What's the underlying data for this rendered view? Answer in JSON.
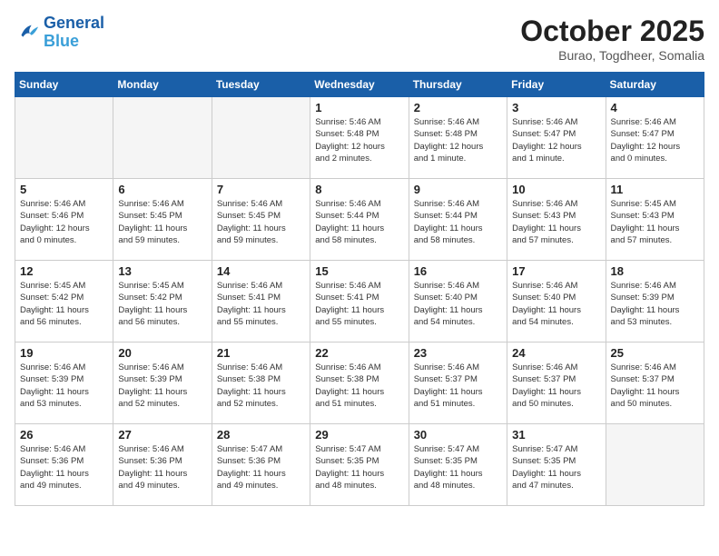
{
  "header": {
    "logo": {
      "line1": "General",
      "line2": "Blue"
    },
    "month": "October 2025",
    "location": "Burao, Togdheer, Somalia"
  },
  "weekdays": [
    "Sunday",
    "Monday",
    "Tuesday",
    "Wednesday",
    "Thursday",
    "Friday",
    "Saturday"
  ],
  "weeks": [
    [
      {
        "day": "",
        "info": ""
      },
      {
        "day": "",
        "info": ""
      },
      {
        "day": "",
        "info": ""
      },
      {
        "day": "1",
        "info": "Sunrise: 5:46 AM\nSunset: 5:48 PM\nDaylight: 12 hours\nand 2 minutes."
      },
      {
        "day": "2",
        "info": "Sunrise: 5:46 AM\nSunset: 5:48 PM\nDaylight: 12 hours\nand 1 minute."
      },
      {
        "day": "3",
        "info": "Sunrise: 5:46 AM\nSunset: 5:47 PM\nDaylight: 12 hours\nand 1 minute."
      },
      {
        "day": "4",
        "info": "Sunrise: 5:46 AM\nSunset: 5:47 PM\nDaylight: 12 hours\nand 0 minutes."
      }
    ],
    [
      {
        "day": "5",
        "info": "Sunrise: 5:46 AM\nSunset: 5:46 PM\nDaylight: 12 hours\nand 0 minutes."
      },
      {
        "day": "6",
        "info": "Sunrise: 5:46 AM\nSunset: 5:45 PM\nDaylight: 11 hours\nand 59 minutes."
      },
      {
        "day": "7",
        "info": "Sunrise: 5:46 AM\nSunset: 5:45 PM\nDaylight: 11 hours\nand 59 minutes."
      },
      {
        "day": "8",
        "info": "Sunrise: 5:46 AM\nSunset: 5:44 PM\nDaylight: 11 hours\nand 58 minutes."
      },
      {
        "day": "9",
        "info": "Sunrise: 5:46 AM\nSunset: 5:44 PM\nDaylight: 11 hours\nand 58 minutes."
      },
      {
        "day": "10",
        "info": "Sunrise: 5:46 AM\nSunset: 5:43 PM\nDaylight: 11 hours\nand 57 minutes."
      },
      {
        "day": "11",
        "info": "Sunrise: 5:45 AM\nSunset: 5:43 PM\nDaylight: 11 hours\nand 57 minutes."
      }
    ],
    [
      {
        "day": "12",
        "info": "Sunrise: 5:45 AM\nSunset: 5:42 PM\nDaylight: 11 hours\nand 56 minutes."
      },
      {
        "day": "13",
        "info": "Sunrise: 5:45 AM\nSunset: 5:42 PM\nDaylight: 11 hours\nand 56 minutes."
      },
      {
        "day": "14",
        "info": "Sunrise: 5:46 AM\nSunset: 5:41 PM\nDaylight: 11 hours\nand 55 minutes."
      },
      {
        "day": "15",
        "info": "Sunrise: 5:46 AM\nSunset: 5:41 PM\nDaylight: 11 hours\nand 55 minutes."
      },
      {
        "day": "16",
        "info": "Sunrise: 5:46 AM\nSunset: 5:40 PM\nDaylight: 11 hours\nand 54 minutes."
      },
      {
        "day": "17",
        "info": "Sunrise: 5:46 AM\nSunset: 5:40 PM\nDaylight: 11 hours\nand 54 minutes."
      },
      {
        "day": "18",
        "info": "Sunrise: 5:46 AM\nSunset: 5:39 PM\nDaylight: 11 hours\nand 53 minutes."
      }
    ],
    [
      {
        "day": "19",
        "info": "Sunrise: 5:46 AM\nSunset: 5:39 PM\nDaylight: 11 hours\nand 53 minutes."
      },
      {
        "day": "20",
        "info": "Sunrise: 5:46 AM\nSunset: 5:39 PM\nDaylight: 11 hours\nand 52 minutes."
      },
      {
        "day": "21",
        "info": "Sunrise: 5:46 AM\nSunset: 5:38 PM\nDaylight: 11 hours\nand 52 minutes."
      },
      {
        "day": "22",
        "info": "Sunrise: 5:46 AM\nSunset: 5:38 PM\nDaylight: 11 hours\nand 51 minutes."
      },
      {
        "day": "23",
        "info": "Sunrise: 5:46 AM\nSunset: 5:37 PM\nDaylight: 11 hours\nand 51 minutes."
      },
      {
        "day": "24",
        "info": "Sunrise: 5:46 AM\nSunset: 5:37 PM\nDaylight: 11 hours\nand 50 minutes."
      },
      {
        "day": "25",
        "info": "Sunrise: 5:46 AM\nSunset: 5:37 PM\nDaylight: 11 hours\nand 50 minutes."
      }
    ],
    [
      {
        "day": "26",
        "info": "Sunrise: 5:46 AM\nSunset: 5:36 PM\nDaylight: 11 hours\nand 49 minutes."
      },
      {
        "day": "27",
        "info": "Sunrise: 5:46 AM\nSunset: 5:36 PM\nDaylight: 11 hours\nand 49 minutes."
      },
      {
        "day": "28",
        "info": "Sunrise: 5:47 AM\nSunset: 5:36 PM\nDaylight: 11 hours\nand 49 minutes."
      },
      {
        "day": "29",
        "info": "Sunrise: 5:47 AM\nSunset: 5:35 PM\nDaylight: 11 hours\nand 48 minutes."
      },
      {
        "day": "30",
        "info": "Sunrise: 5:47 AM\nSunset: 5:35 PM\nDaylight: 11 hours\nand 48 minutes."
      },
      {
        "day": "31",
        "info": "Sunrise: 5:47 AM\nSunset: 5:35 PM\nDaylight: 11 hours\nand 47 minutes."
      },
      {
        "day": "",
        "info": ""
      }
    ]
  ]
}
